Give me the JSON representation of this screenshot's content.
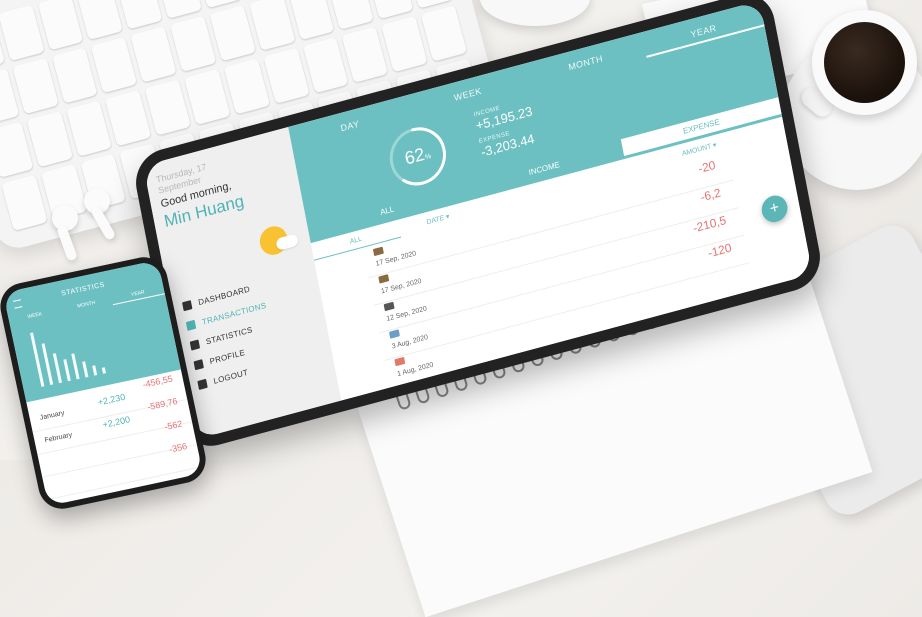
{
  "tablet": {
    "period_tabs": [
      "DAY",
      "WEEK",
      "MONTH",
      "YEAR"
    ],
    "active_period": "YEAR",
    "summary": {
      "percent": "62",
      "percent_unit": "%",
      "income_label": "INCOME",
      "income_value": "+5,195.23",
      "expense_label": "EXPENSE",
      "expense_value": "-3,203.44"
    },
    "type_tabs": [
      "ALL",
      "INCOME",
      "EXPENSE"
    ],
    "active_type": "EXPENSE",
    "greeting": {
      "date_line1": "Thursday, 17",
      "date_line2": "September",
      "hello": "Good morning,",
      "name": "Min Huang"
    },
    "nav": [
      {
        "label": "DASHBOARD",
        "icon": "dashboard-icon"
      },
      {
        "label": "TRANSACTIONS",
        "icon": "transactions-icon"
      },
      {
        "label": "STATISTICS",
        "icon": "statistics-icon"
      },
      {
        "label": "PROFILE",
        "icon": "profile-icon"
      },
      {
        "label": "LOGOUT",
        "icon": "logout-icon"
      }
    ],
    "active_nav": "TRANSACTIONS",
    "filters": {
      "all": "ALL",
      "date": "DATE ▾",
      "amount": "AMOUNT ▾"
    },
    "transactions": [
      {
        "date": "17 Sep, 2020",
        "amount": "-20"
      },
      {
        "date": "17 Sep, 2020",
        "amount": "-6,2"
      },
      {
        "date": "12 Sep, 2020",
        "amount": "-210,5"
      },
      {
        "date": "3 Aug, 2020",
        "amount": "-120"
      },
      {
        "date": "1 Aug, 2020",
        "amount": ""
      }
    ],
    "fab": "+"
  },
  "phone": {
    "title": "STATISTICS",
    "tabs": [
      "WEEK",
      "MONTH",
      "YEAR"
    ],
    "active_tab": "YEAR",
    "rows": [
      {
        "month": "January",
        "income": "+2,230",
        "expense": "-456,55"
      },
      {
        "month": "February",
        "income": "+2,200",
        "expense": "-589,76"
      },
      {
        "month": "",
        "income": "",
        "expense": "-562"
      },
      {
        "month": "",
        "income": "",
        "expense": "-356"
      }
    ]
  },
  "colors": {
    "teal": "#6cc0c2",
    "expense_red": "#e57373",
    "sun": "#f8c232"
  }
}
